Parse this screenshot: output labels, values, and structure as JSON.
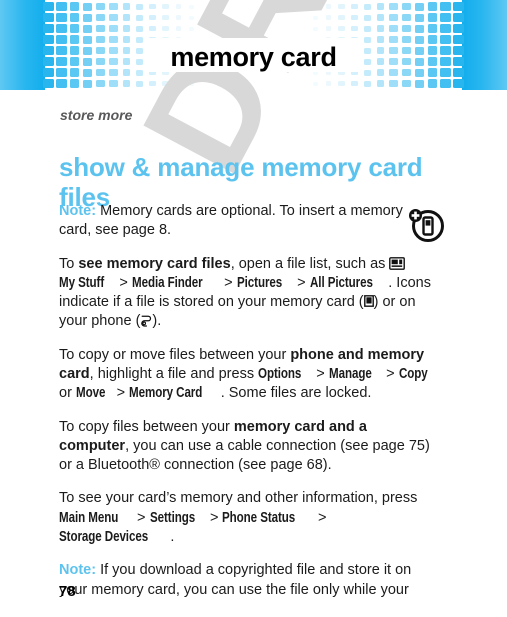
{
  "header": {
    "title": "memory card",
    "accent_color": "#29b6ef",
    "edge_color": "#12aeed",
    "grid_columns": 12,
    "grid_rows": 8
  },
  "watermark": {
    "text": "DRAFT",
    "color": "#d8d8d8"
  },
  "page": {
    "kicker": "store more",
    "heading": "show & manage memory card files",
    "heading_color": "#5cc3ef",
    "number": "78"
  },
  "margin_icon": {
    "name": "add-memory-card-icon"
  },
  "body": {
    "p1": {
      "note_label": "Note:",
      "text": " Memory cards are optional. To insert a memory card, see page 8."
    },
    "p2": {
      "lead": "To ",
      "bold1": "see memory card files",
      "mid1": ", open a file list, such as ",
      "menu1": "My Stuff",
      "sep1": " > ",
      "menu2": "Media Finder",
      "sep2": " > ",
      "menu3": "Pictures",
      "sep3": " > ",
      "menu4": "All Pictures",
      "mid2": ". Icons indicate if a file is stored on your memory card (",
      "mid3": ") or on your phone (",
      "tail": ")."
    },
    "p3": {
      "lead": "To copy or move files between your ",
      "bold1": "phone and memory card",
      "mid1": ", highlight a file and press ",
      "menu1": "Options",
      "sep1": " > ",
      "menu2": "Manage",
      "sep2": " > ",
      "menu3": "Copy",
      "mid2": " or ",
      "menu4": "Move",
      "sep3": " > ",
      "menu5": "Memory Card",
      "tail": ". Some files are locked."
    },
    "p4": {
      "lead": "To copy files between your ",
      "bold1": "memory card and a computer",
      "tail": ", you can use a cable connection (see page 75) or a Bluetooth® connection (see page 68)."
    },
    "p5": {
      "lead": "To see your card’s memory and other information, press ",
      "menu1": "Main Menu",
      "sep1": " > ",
      "menu2": "Settings",
      "sep2": " > ",
      "menu3": "Phone Status",
      "sep3": " > ",
      "menu4": "Storage Devices",
      "tail": "."
    },
    "p6": {
      "note_label": "Note:",
      "text": " If you download a copyrighted file and store it on your memory card, you can use the file only while your"
    }
  }
}
